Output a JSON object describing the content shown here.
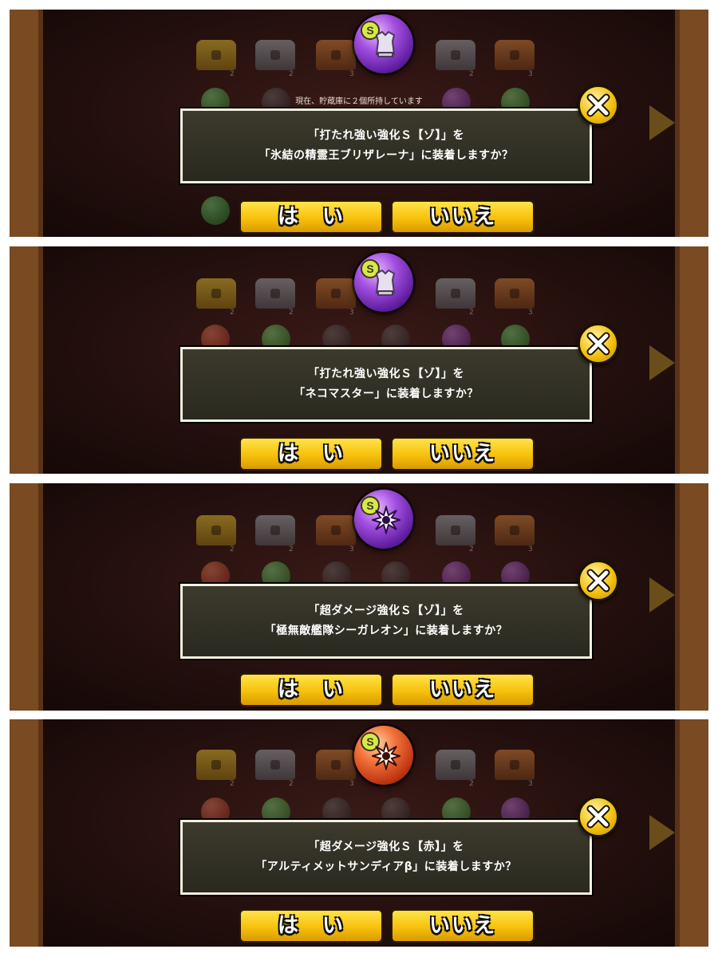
{
  "panels": [
    {
      "owned_text": "現在、貯蔵庫に２個所持しています",
      "line1": "「打たれ強い強化Ｓ【ゾ】」を",
      "line2": "「氷結の精霊王ブリザレーナ」に装着しますか？",
      "orb_color": "purple",
      "orb_icon": "armor-icon",
      "yes_label": "は　い",
      "no_label": "いいえ"
    },
    {
      "owned_text": "",
      "line1": "「打たれ強い強化Ｓ【ゾ】」を",
      "line2": "「ネコマスター」に装着しますか？",
      "orb_color": "purple",
      "orb_icon": "armor-icon",
      "yes_label": "は　い",
      "no_label": "いいえ"
    },
    {
      "owned_text": "",
      "line1": "「超ダメージ強化Ｓ【ゾ】」を",
      "line2": "「極無敵艦隊シーガレオン」に装着しますか？",
      "orb_color": "purple",
      "orb_icon": "burst-icon",
      "yes_label": "は　い",
      "no_label": "いいえ"
    },
    {
      "owned_text": "",
      "line1": "「超ダメージ強化Ｓ【赤】」を",
      "line2": "「アルティメットサンディアβ」に装着しますか？",
      "orb_color": "red",
      "orb_icon": "burst-icon",
      "yes_label": "は　い",
      "no_label": "いいえ"
    }
  ],
  "orb_rank_letter": "S",
  "chest_counts": [
    "2",
    "2",
    "3",
    "2",
    "3"
  ],
  "colors": {
    "frame": "#7a4a22",
    "button_yellow": "#f7c10c",
    "dialog_bg": "#2a291f",
    "orb_purple": "#a24fe0",
    "orb_red": "#f2703a"
  }
}
